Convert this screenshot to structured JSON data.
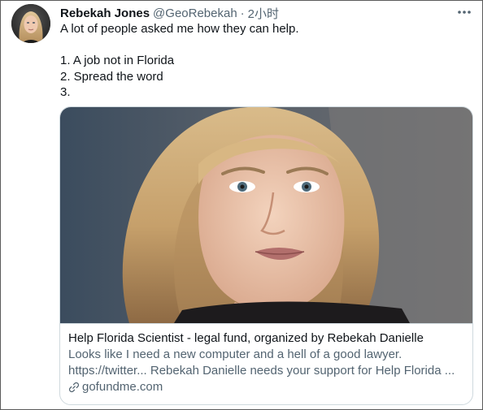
{
  "tweet": {
    "display_name": "Rebekah Jones",
    "handle": "@GeoRebekah",
    "separator": "·",
    "timestamp": "2小时",
    "text_lines": [
      "A lot of people asked me how they can help.",
      "",
      "1. A job not in Florida",
      "2. Spread the word",
      "3."
    ]
  },
  "card": {
    "title": "Help Florida Scientist - legal fund, organized by Rebekah Danielle",
    "description_lines": [
      "Looks like I need a new computer and a hell of a good lawyer.",
      "https://twitter... Rebekah Danielle needs your support for Help Florida ..."
    ],
    "domain": "gofundme.com"
  },
  "icons": {
    "more": "more-horizontal-icon",
    "link": "link-icon"
  },
  "colors": {
    "text_primary": "#0f1419",
    "text_secondary": "#536471",
    "card_border": "#cfd9de"
  }
}
